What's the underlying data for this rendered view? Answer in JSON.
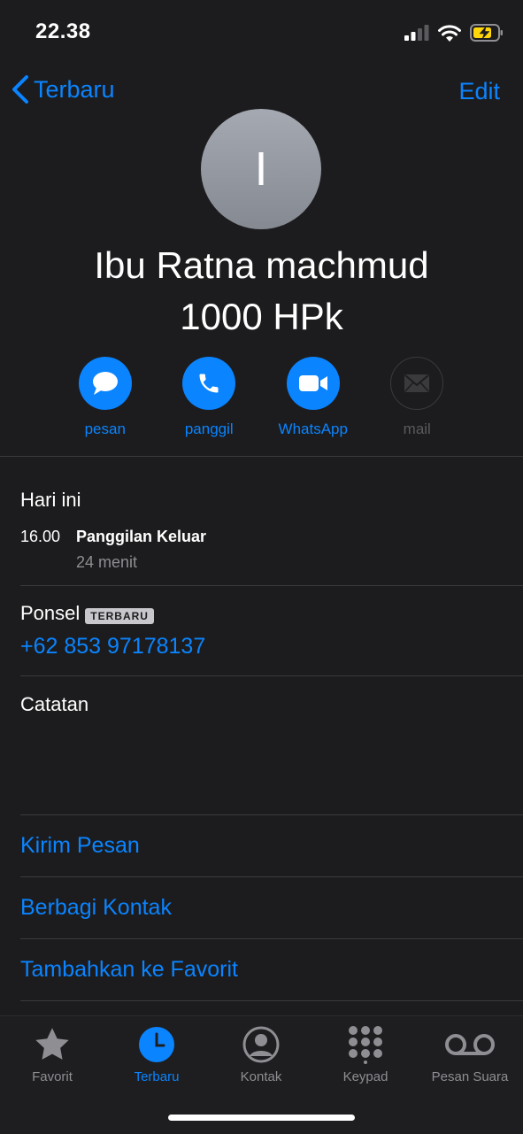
{
  "status_bar": {
    "time": "22.38"
  },
  "nav": {
    "back_label": "Terbaru",
    "edit_label": "Edit"
  },
  "contact": {
    "avatar_initial": "I",
    "name_line1": "Ibu Ratna machmud",
    "name_line2": "1000 HPk"
  },
  "actions": [
    {
      "label": "pesan",
      "icon": "message-icon",
      "enabled": true
    },
    {
      "label": "panggil",
      "icon": "phone-icon",
      "enabled": true
    },
    {
      "label": "WhatsApp",
      "icon": "video-icon",
      "enabled": true
    },
    {
      "label": "mail",
      "icon": "mail-icon",
      "enabled": false
    }
  ],
  "recent": {
    "heading": "Hari ini",
    "time": "16.00",
    "type": "Panggilan Keluar",
    "duration": "24 menit"
  },
  "phone": {
    "label": "Ponsel",
    "badge": "TERBARU",
    "number": "+62 853 97178137"
  },
  "notes": {
    "label": "Catatan"
  },
  "links": {
    "send_message": "Kirim Pesan",
    "share_contact": "Berbagi Kontak",
    "add_favorite": "Tambahkan ke Favorit"
  },
  "tabs": [
    {
      "label": "Favorit",
      "icon": "star-icon",
      "active": false
    },
    {
      "label": "Terbaru",
      "icon": "clock-icon",
      "active": true
    },
    {
      "label": "Kontak",
      "icon": "person-circle-icon",
      "active": false
    },
    {
      "label": "Keypad",
      "icon": "keypad-icon",
      "active": false
    },
    {
      "label": "Pesan Suara",
      "icon": "voicemail-icon",
      "active": false
    }
  ],
  "colors": {
    "accent": "#0a84ff",
    "background": "#1c1c1e",
    "battery": "#ffd60a"
  }
}
